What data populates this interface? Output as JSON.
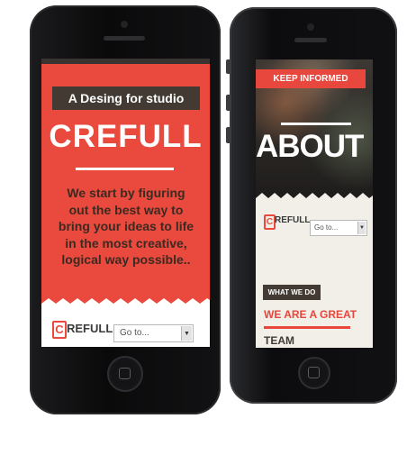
{
  "left_phone": {
    "tagline": "A Desing for studio",
    "title": "CREFULL",
    "intro": "We start by figuring out the best way to bring your ideas to life in the most creative, logical way possible..",
    "logo_letter": "C",
    "logo_text": "REFULL",
    "goto_select": "Go to..."
  },
  "right_phone": {
    "keep_informed": "KEEP INFORMED",
    "about_title": "ABOUT US",
    "logo_letter": "C",
    "logo_text": "REFULL",
    "goto_select": "Go to...",
    "what_we_do": "WHAT WE DO",
    "heading_line1": "WE ARE A GREAT",
    "heading_line2": "TEAM"
  },
  "colors": {
    "brand_red": "#ea4a3d",
    "dark_brown": "#433b33",
    "cream": "#f1efe8"
  },
  "icons": [
    "dropdown-arrow-icon",
    "home-button-icon"
  ]
}
